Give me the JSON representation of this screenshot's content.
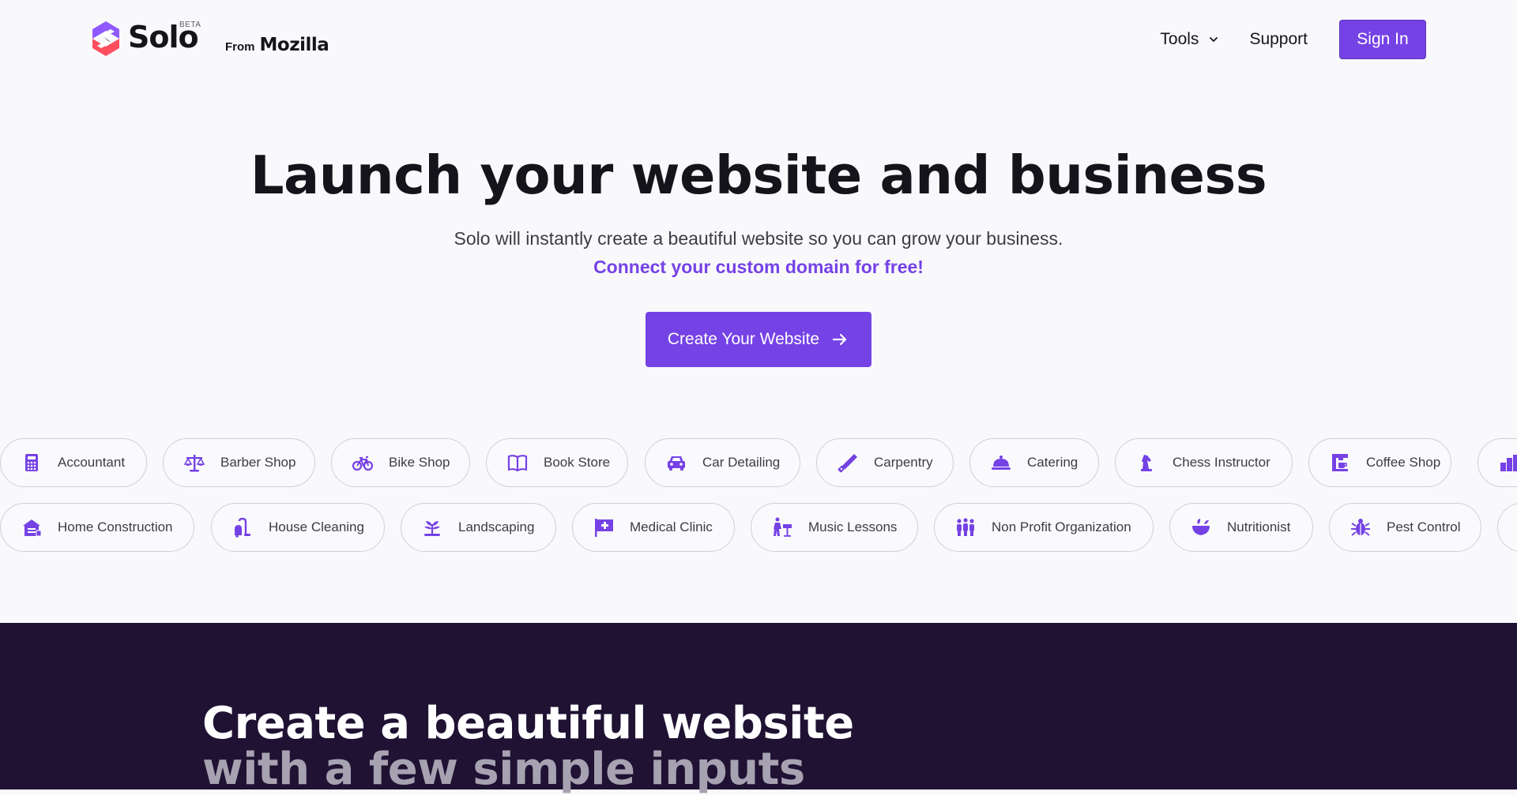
{
  "header": {
    "logo_text": "Solo",
    "beta_label": "BETA",
    "from_label": "From",
    "mozilla_text": "Mozilla",
    "nav": {
      "tools_label": "Tools",
      "support_label": "Support",
      "signin_label": "Sign In"
    }
  },
  "hero": {
    "title": "Launch your website and business",
    "subtitle": "Solo will instantly create a beautiful website so you can grow your business.",
    "link": "Connect your custom domain for free!",
    "cta_label": "Create Your Website"
  },
  "categories": {
    "row1": [
      {
        "label": "Accountant",
        "icon": "calculator-icon"
      },
      {
        "label": "Barber Shop",
        "icon": "scale-icon"
      },
      {
        "label": "Bike Shop",
        "icon": "bicycle-icon"
      },
      {
        "label": "Book Store",
        "icon": "book-icon"
      },
      {
        "label": "Car Detailing",
        "icon": "car-icon"
      },
      {
        "label": "Carpentry",
        "icon": "saw-icon"
      },
      {
        "label": "Catering",
        "icon": "cloche-icon"
      },
      {
        "label": "Chess Instructor",
        "icon": "chess-knight-icon"
      },
      {
        "label": "Coffee Shop",
        "icon": "coffee-machine-icon"
      },
      {
        "label": "",
        "icon": "building-icon"
      }
    ],
    "row2": [
      {
        "label": "Home Construction",
        "icon": "house-construction-icon"
      },
      {
        "label": "House Cleaning",
        "icon": "vacuum-icon"
      },
      {
        "label": "Landscaping",
        "icon": "plant-icon"
      },
      {
        "label": "Medical Clinic",
        "icon": "medical-flag-icon"
      },
      {
        "label": "Music Lessons",
        "icon": "music-stand-icon"
      },
      {
        "label": "Non Profit Organization",
        "icon": "people-icon"
      },
      {
        "label": "Nutritionist",
        "icon": "bowl-icon"
      },
      {
        "label": "Pest Control",
        "icon": "bug-icon"
      },
      {
        "label": "",
        "icon": "generic-icon"
      }
    ]
  },
  "feature": {
    "title": "Create a beautiful website",
    "subtitle": "with a few simple inputs"
  },
  "colors": {
    "accent": "#7542e5",
    "dark_section": "#1f1233",
    "background": "#f9f9fc"
  }
}
